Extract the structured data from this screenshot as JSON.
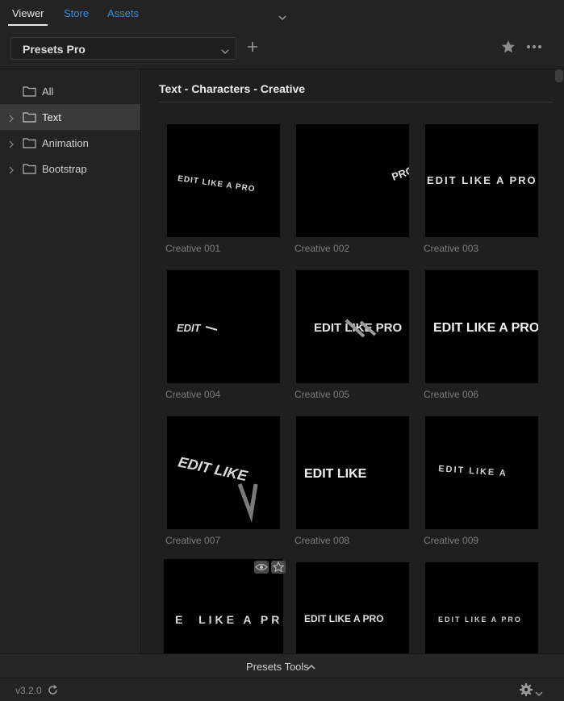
{
  "tabs": [
    {
      "label": "Viewer",
      "active": true
    },
    {
      "label": "Store",
      "active": false
    },
    {
      "label": "Assets",
      "active": false
    }
  ],
  "preset_selector": {
    "value": "Presets Pro"
  },
  "icons": {
    "tabs_more": "chevron-down-icon",
    "add": "plus-icon",
    "favorite": "star-icon",
    "more": "ellipsis-icon",
    "folder": "folder-icon",
    "preview": "eye-icon",
    "favorite_small": "star-outline-icon",
    "refresh": "refresh-icon",
    "settings": "gear-icon"
  },
  "sidebar": {
    "items": [
      {
        "label": "All",
        "expandable": false,
        "selected": false
      },
      {
        "label": "Text",
        "expandable": true,
        "selected": true
      },
      {
        "label": "Animation",
        "expandable": true,
        "selected": false
      },
      {
        "label": "Bootstrap",
        "expandable": true,
        "selected": false
      }
    ]
  },
  "main": {
    "section_title": "Text - Characters - Creative",
    "cards": [
      {
        "label": "Creative 001",
        "preview": "EDIT LIKE A PRO"
      },
      {
        "label": "Creative 002",
        "preview": "PRO"
      },
      {
        "label": "Creative 003",
        "preview": "EDIT LIKE A PRO"
      },
      {
        "label": "Creative 004",
        "preview": "EDIT"
      },
      {
        "label": "Creative 005",
        "preview": "EDIT LIKE PRO"
      },
      {
        "label": "Creative 006",
        "preview": "EDIT LIKE A PRO"
      },
      {
        "label": "Creative 007",
        "preview": "EDIT LIKE"
      },
      {
        "label": "Creative 008",
        "preview": "EDIT LIKE"
      },
      {
        "label": "Creative 009",
        "preview": "EDIT LIKE A"
      },
      {
        "label": "",
        "preview": "E  LIKE A PRO  O"
      },
      {
        "label": "",
        "preview": "EDIT LIKE A PRO"
      },
      {
        "label": "",
        "preview": "EDIT LIKE A PRO"
      }
    ]
  },
  "footer": {
    "tools_label": "Presets Tools",
    "version": "v3.2.0"
  },
  "colors": {
    "accent_link": "#3d8ee0",
    "background": "#232323",
    "panel": "#1f1f1f",
    "selected": "#3a3a3a"
  }
}
